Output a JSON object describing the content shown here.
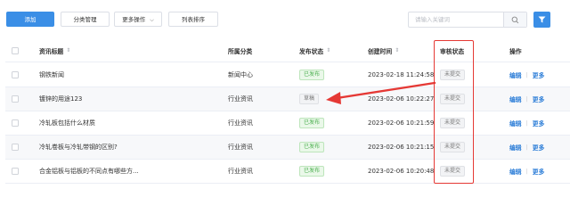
{
  "toolbar": {
    "add_label": "添加",
    "category_label": "分类管理",
    "more_label": "更多操作",
    "sort_label": "列表排序"
  },
  "search": {
    "placeholder": "请输入关键词"
  },
  "icons": {
    "search": "search-icon",
    "filter": "filter-icon",
    "chevron": "chevron-down-icon",
    "sort": "sort-icon",
    "arrow": "annotation-arrow"
  },
  "colors": {
    "primary": "#3a8ee6",
    "published_green": "#4caf50",
    "highlight_red": "#e53935"
  },
  "table": {
    "headers": {
      "title": "资讯标题",
      "category": "所属分类",
      "publish_status": "发布状态",
      "created_time": "创建时间",
      "review_status": "审核状态",
      "actions": "操作"
    },
    "rows": [
      {
        "title": "钢铁新闻",
        "category": "新闻中心",
        "publish_status": "已发布",
        "created_time": "2023-02-18 11:24:58",
        "review_status": "未提交",
        "edit": "编辑",
        "more": "更多"
      },
      {
        "title": "镀锌的用途123",
        "category": "行业资讯",
        "publish_status": "草稿",
        "created_time": "2023-02-06 10:22:27",
        "review_status": "未提交",
        "edit": "编辑",
        "more": "更多"
      },
      {
        "title": "冷轧板包括什么材质",
        "category": "行业资讯",
        "publish_status": "已发布",
        "created_time": "2023-02-06 10:21:59",
        "review_status": "未提交",
        "edit": "编辑",
        "more": "更多"
      },
      {
        "title": "冷轧卷板与冷轧带钢的区别?",
        "category": "行业资讯",
        "publish_status": "已发布",
        "created_time": "2023-02-06 10:21:15",
        "review_status": "未提交",
        "edit": "编辑",
        "more": "更多"
      },
      {
        "title": "合金铝板与铝板的不同点有哪些方...",
        "category": "行业资讯",
        "publish_status": "已发布",
        "created_time": "2023-02-06 10:20:48",
        "review_status": "未提交",
        "edit": "编辑",
        "more": "更多"
      }
    ]
  }
}
